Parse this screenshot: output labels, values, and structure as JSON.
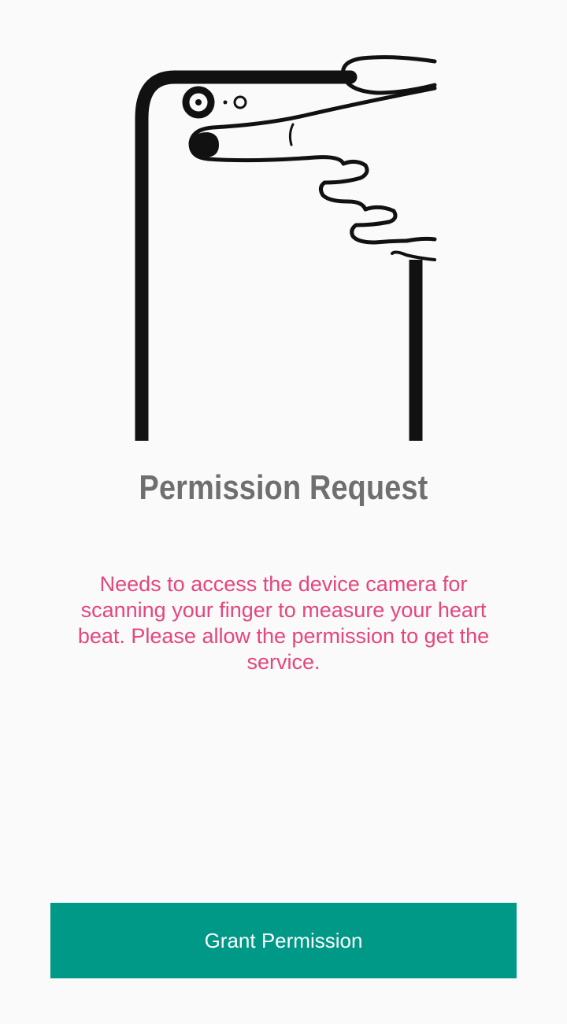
{
  "permission_screen": {
    "illustration_icon": "finger-on-camera-illustration",
    "title": "Permission Request",
    "description": "Needs to access the device camera for scanning your finger to measure your heart beat. Please allow the permission to get the service.",
    "grant_button_label": "Grant Permission"
  },
  "colors": {
    "background": "#fafafa",
    "title": "#6f6f6f",
    "description": "#e4467e",
    "button": "#009886",
    "button_text": "#ffffff"
  }
}
